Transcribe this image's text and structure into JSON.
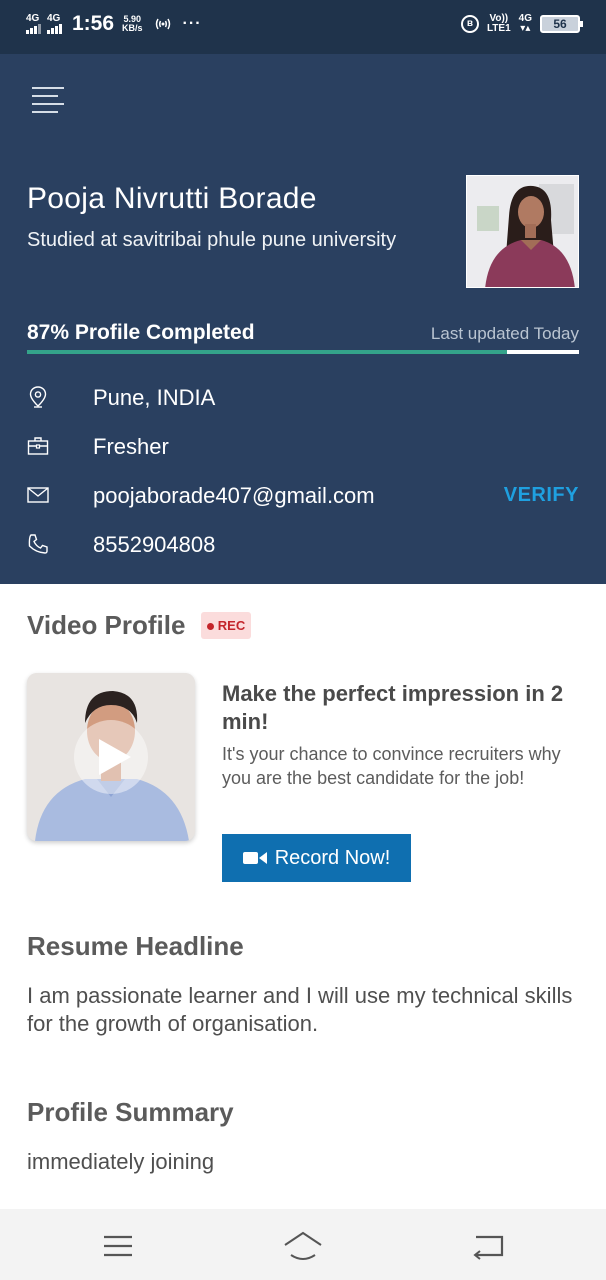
{
  "status_bar": {
    "network_1": "4G",
    "network_2": "4G",
    "time": "1:56",
    "speed_value": "5.90",
    "speed_unit": "KB/s",
    "dots": "···",
    "volte_top": "Vo))",
    "volte_bottom": "LTE1",
    "network_3": "4G",
    "battery_level": "56"
  },
  "profile": {
    "name": "Pooja Nivrutti Borade",
    "education": "Studied at savitribai phule pune university",
    "completion_text": "87% Profile Completed",
    "completion_percent": 87,
    "last_updated": "Last updated Today",
    "location": "Pune, INDIA",
    "experience": "Fresher",
    "email": "poojaborade407@gmail.com",
    "verify_label": "VERIFY",
    "phone": "8552904808"
  },
  "video_profile": {
    "title": "Video Profile",
    "badge": "REC",
    "promo_title": "Make the perfect impression in 2 min!",
    "promo_body": "It's your chance to convince recruiters why you are the best candidate for the job!",
    "button_label": "Record Now!"
  },
  "resume_headline": {
    "title": "Resume Headline",
    "text": "I am passionate learner and I will use my technical skills for the growth of organisation."
  },
  "profile_summary": {
    "title": "Profile Summary",
    "text": "immediately joining"
  },
  "colors": {
    "header_bg": "#2a4060",
    "accent_green": "#34a38a",
    "verify_blue": "#1fa0e0",
    "button_blue": "#0f6fb0"
  }
}
